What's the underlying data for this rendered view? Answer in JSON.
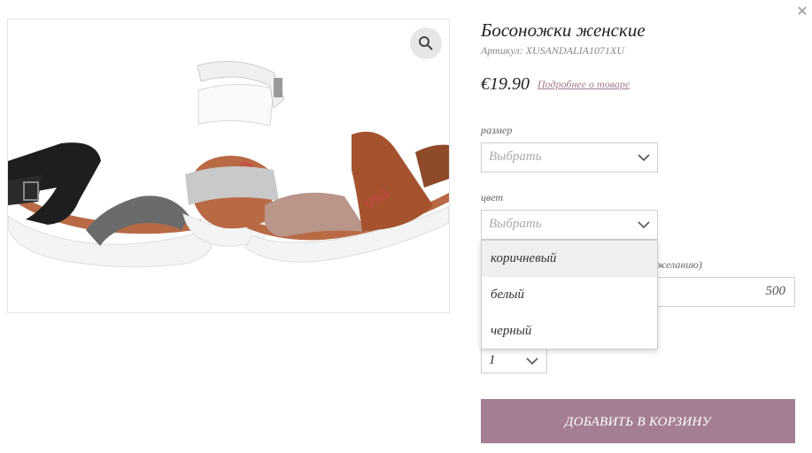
{
  "close_icon": "close-icon",
  "product": {
    "title": "Босоножки женские",
    "sku": "Артикул: XUSANDALIA1071XU",
    "price": "€19.90",
    "more_link": "Подробнее о товаре"
  },
  "size": {
    "label": "размер",
    "value": "Выбрать"
  },
  "color": {
    "label": "цвет",
    "value": "Выбрать",
    "options": [
      "коричневый",
      "белый",
      "черный"
    ]
  },
  "custom_field": {
    "label_partial": "желанию)",
    "value": "500"
  },
  "quantity": {
    "value": "1"
  },
  "add_to_cart": "ДОБАВИТЬ В КОРЗИНУ",
  "colors": {
    "accent": "#a47f94",
    "link": "#a07b92"
  }
}
